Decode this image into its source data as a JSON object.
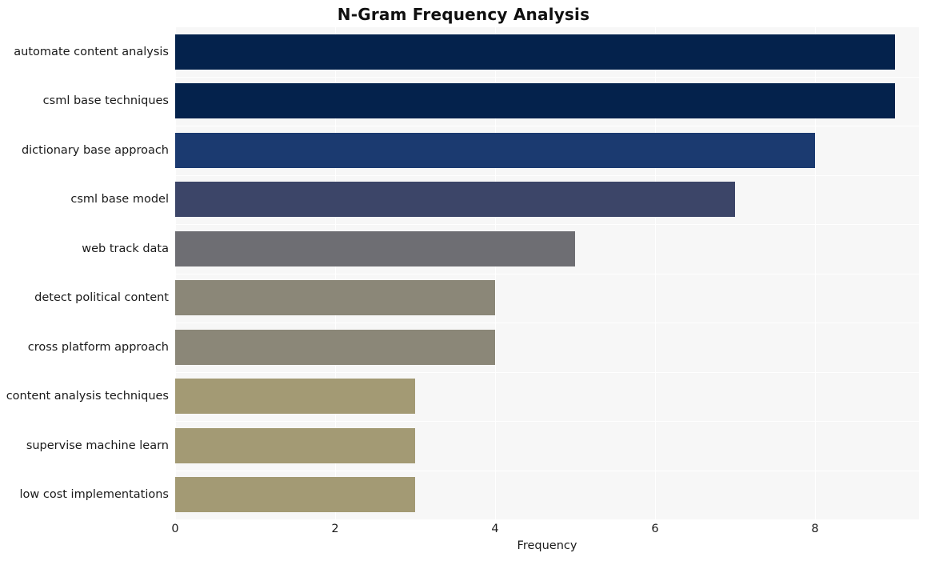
{
  "chart_data": {
    "type": "bar",
    "orientation": "horizontal",
    "title": "N-Gram Frequency Analysis",
    "xlabel": "Frequency",
    "ylabel": "",
    "xlim": [
      0,
      9.3
    ],
    "xticks": [
      0,
      2,
      4,
      6,
      8
    ],
    "grid": true,
    "legend": null,
    "categories": [
      "automate content analysis",
      "csml base techniques",
      "dictionary base approach",
      "csml base model",
      "web track data",
      "detect political content",
      "cross platform approach",
      "content analysis techniques",
      "supervise machine learn",
      "low cost implementations"
    ],
    "values": [
      9,
      9,
      8,
      7,
      5,
      4,
      4,
      3,
      3,
      3
    ],
    "bar_colors": [
      "#04224c",
      "#04224c",
      "#1b3a70",
      "#3c4568",
      "#6e6e73",
      "#8b8778",
      "#8b8778",
      "#a39a74",
      "#a39a74",
      "#a39a74"
    ],
    "plot_background": "#f7f7f7",
    "grid_color": "#ffffff"
  }
}
